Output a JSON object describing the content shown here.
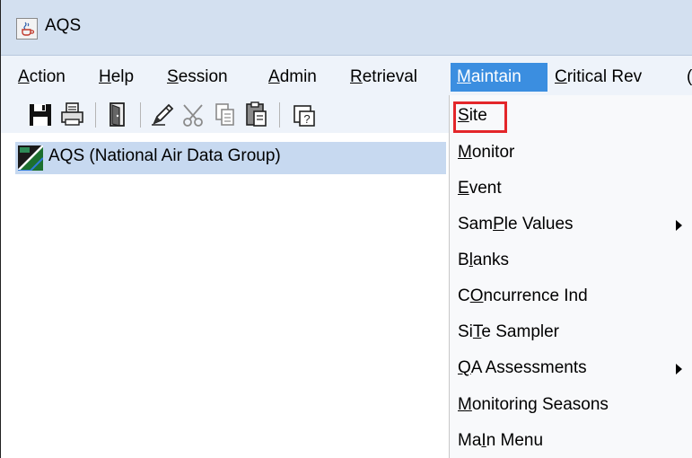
{
  "window": {
    "title": "AQS",
    "icon": "java-cup-icon"
  },
  "menubar": {
    "items": [
      {
        "label_pre": "",
        "mnemonic": "A",
        "label_post": "ction"
      },
      {
        "label_pre": "",
        "mnemonic": "H",
        "label_post": "elp"
      },
      {
        "label_pre": "",
        "mnemonic": "S",
        "label_post": "ession"
      },
      {
        "label_pre": "",
        "mnemonic": "A",
        "label_post": "dmin"
      },
      {
        "label_pre": "",
        "mnemonic": "R",
        "label_post": "etrieval"
      },
      {
        "label_pre": "",
        "mnemonic": "M",
        "label_post": "aintain"
      },
      {
        "label_pre": "",
        "mnemonic": "C",
        "label_post": "ritical Rev"
      },
      {
        "label_pre": "",
        "mnemonic": "",
        "label_post": "("
      }
    ],
    "active": "Maintain"
  },
  "toolbar": {
    "buttons": [
      "save-icon",
      "print-icon",
      "exit-door-icon",
      "edit-pencil-icon",
      "cut-scissors-icon",
      "copy-icon",
      "paste-icon",
      "help-icon"
    ]
  },
  "tree": {
    "root_label": "AQS (National Air Data Group)"
  },
  "maintain_menu": {
    "items": [
      {
        "pre": "",
        "mn": "S",
        "post": "ite",
        "submenu": false
      },
      {
        "pre": "",
        "mn": "M",
        "post": "onitor",
        "submenu": false
      },
      {
        "pre": "",
        "mn": "E",
        "post": "vent",
        "submenu": false
      },
      {
        "pre": "Sam",
        "mn": "P",
        "post": "le Values",
        "submenu": true
      },
      {
        "pre": "B",
        "mn": "l",
        "post": "anks",
        "submenu": false
      },
      {
        "pre": "C",
        "mn": "O",
        "post": "ncurrence Ind",
        "submenu": false
      },
      {
        "pre": "Si",
        "mn": "T",
        "post": "e Sampler",
        "submenu": false
      },
      {
        "pre": "",
        "mn": "Q",
        "post": "A Assessments",
        "submenu": true
      },
      {
        "pre": "",
        "mn": "M",
        "post": "onitoring Seasons",
        "submenu": false
      },
      {
        "pre": "Ma",
        "mn": "I",
        "post": "n Menu",
        "submenu": false
      }
    ]
  },
  "colors": {
    "titlebar_bg": "#d3e0f0",
    "menu_active_bg": "#3b8ee0",
    "tree_selection_bg": "#c7d9f0",
    "highlight_border": "#e3262a"
  }
}
